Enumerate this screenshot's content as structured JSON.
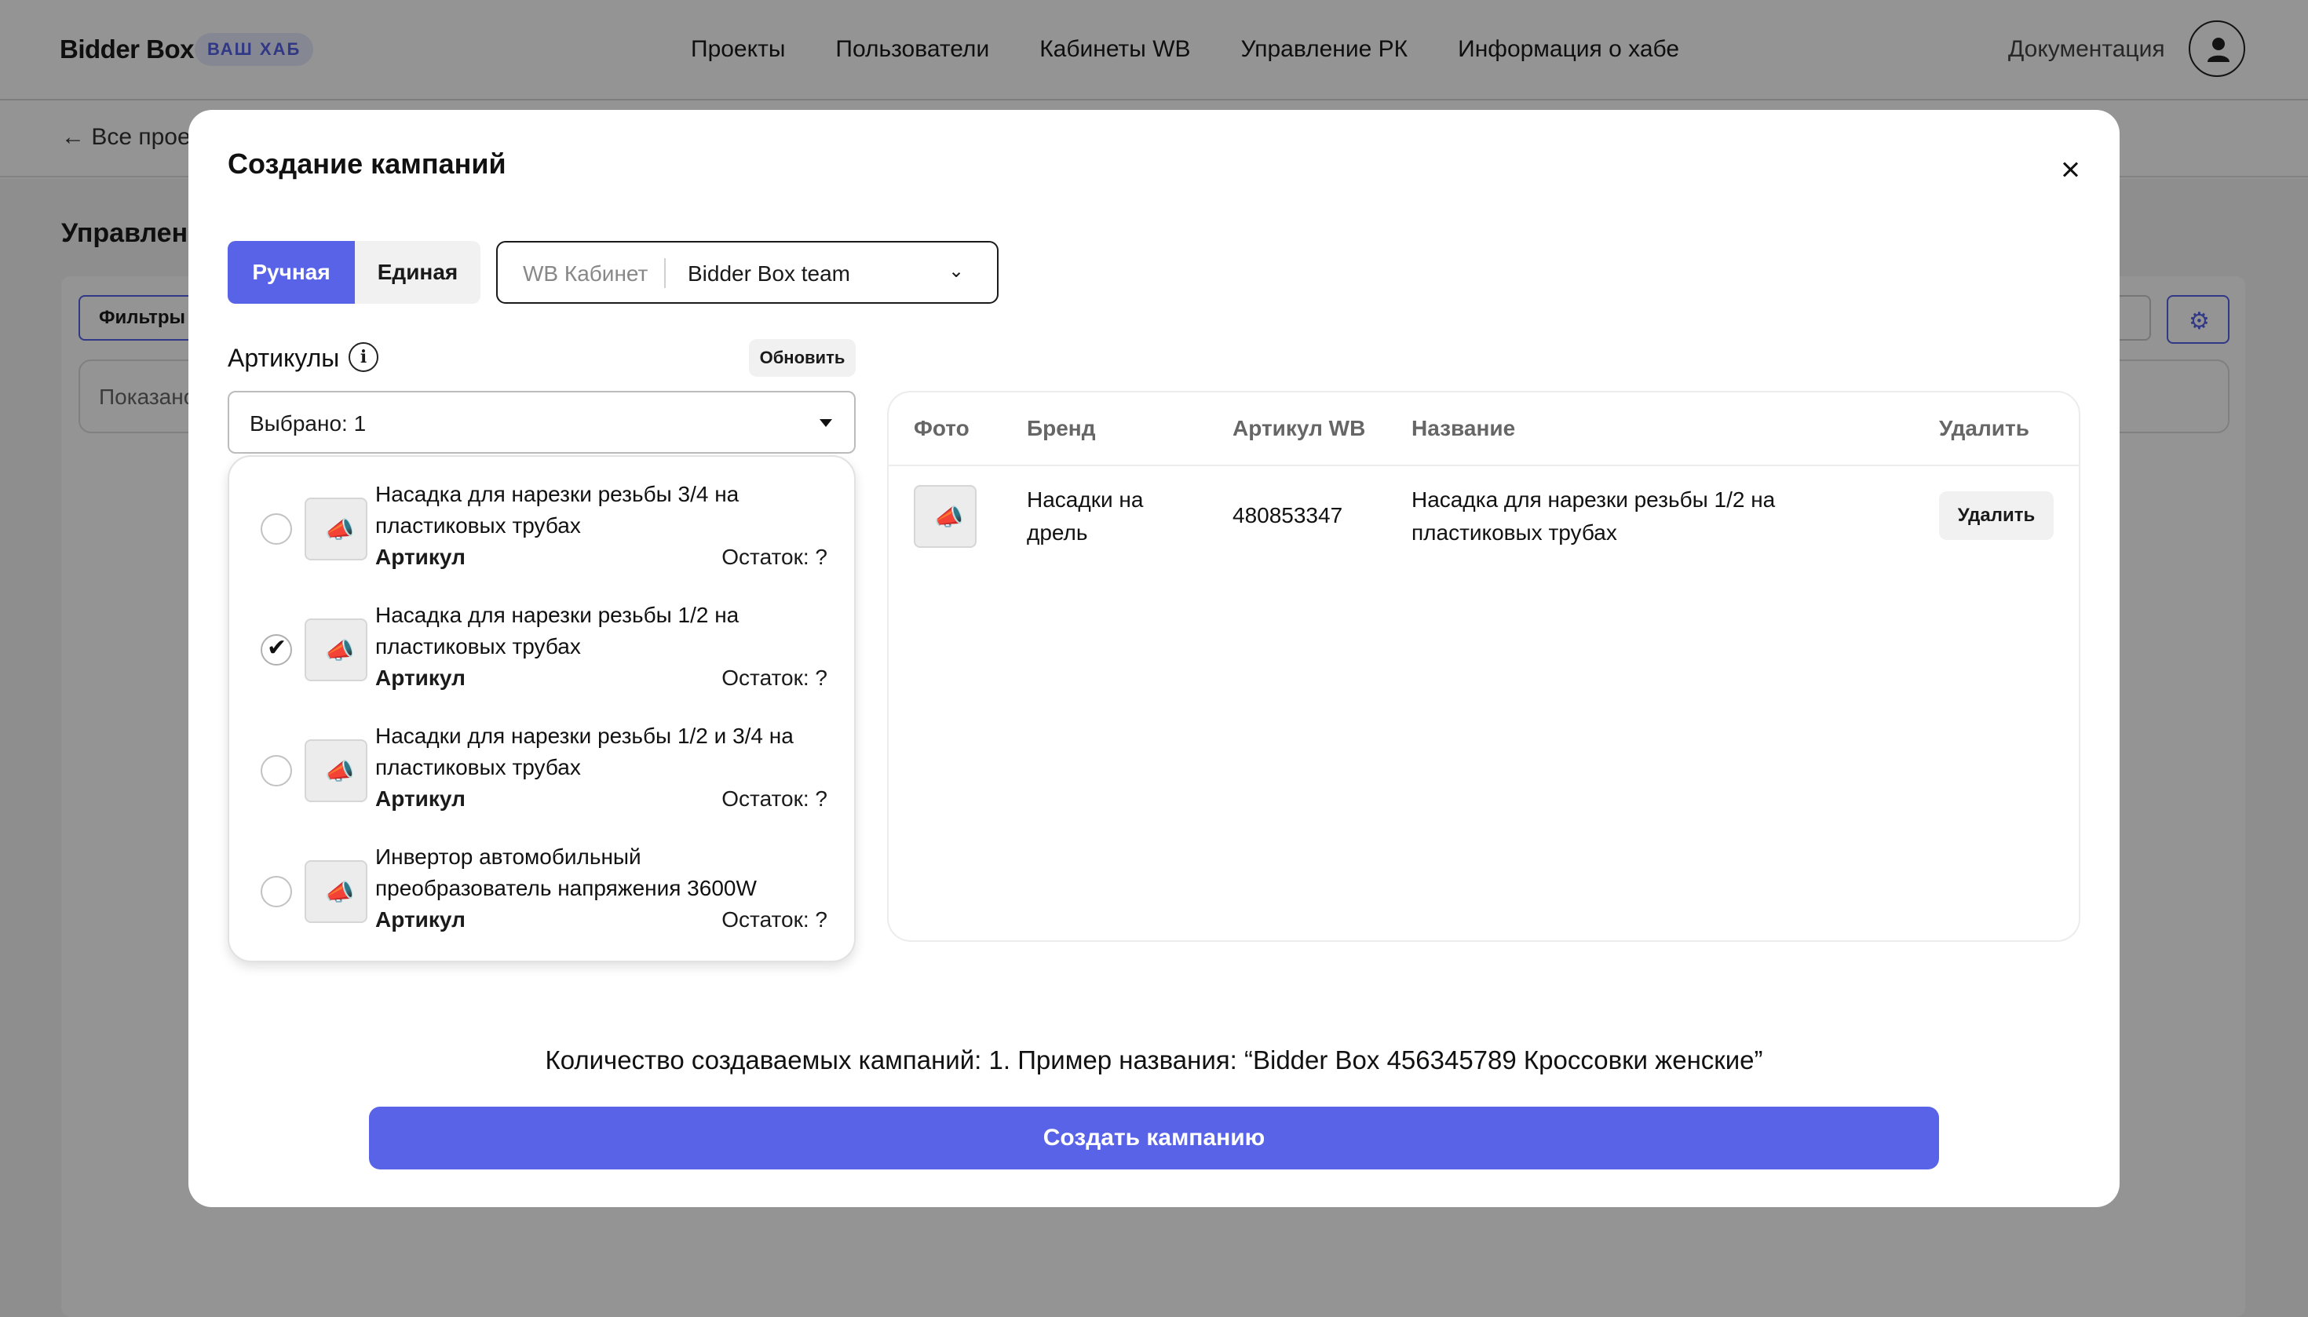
{
  "header": {
    "logo": "Bidder Box",
    "hub_badge": "ВАШ ХАБ",
    "nav": [
      "Проекты",
      "Пользователи",
      "Кабинеты WB",
      "Управление РК",
      "Информация о хабе"
    ],
    "docs": "Документация"
  },
  "background": {
    "back_link": "Все проек",
    "page_title": "Управлени",
    "filters_button": "Фильтры",
    "showing_text": "Показано"
  },
  "modal": {
    "title": "Создание кампаний",
    "mode_tabs": [
      {
        "label": "Ручная",
        "active": true
      },
      {
        "label": "Единая",
        "active": false
      }
    ],
    "cabinet": {
      "label": "WB Кабинет",
      "value": "Bidder Box team"
    },
    "articles": {
      "label": "Артикулы",
      "info_icon": "i",
      "refresh_button": "Обновить",
      "selected_text": "Выбрано: 1",
      "options": [
        {
          "name": "Насадка для нарезки резьбы 3/4 на пластиковых трубах",
          "article_label": "Артикул",
          "stock": "Остаток: ?",
          "checked": false
        },
        {
          "name": "Насадка для нарезки резьбы 1/2 на пластиковых трубах",
          "article_label": "Артикул",
          "stock": "Остаток: ?",
          "checked": true
        },
        {
          "name": "Насадки для нарезки резьбы 1/2 и 3/4 на пластиковых трубах",
          "article_label": "Артикул",
          "stock": "Остаток: ?",
          "checked": false
        },
        {
          "name": "Инвертор автомобильный преобразователь напряжения 3600W",
          "article_label": "Артикул",
          "stock": "Остаток: ?",
          "checked": false
        }
      ]
    },
    "table": {
      "headers": {
        "photo": "Фото",
        "brand": "Бренд",
        "article": "Артикул WB",
        "name": "Название",
        "delete": "Удалить"
      },
      "rows": [
        {
          "brand": "Насадки на дрель",
          "article": "480853347",
          "name": "Насадка для нарезки резьбы 1/2 на пластиковых трубах",
          "delete_label": "Удалить"
        }
      ]
    },
    "summary": "Количество создаваемых кампаний: 1. Пример названия: “Bidder Box 456345789 Кроссовки женские”",
    "create_button": "Создать кампанию"
  },
  "colors": {
    "accent": "#5863e8",
    "overlay": "rgba(0,0,0,0.42)"
  },
  "icons": [
    "arrow-left-icon",
    "user-icon",
    "gear-icon",
    "close-icon",
    "chevron-down-icon",
    "info-icon",
    "caret-down-icon",
    "megaphone-icon",
    "check-icon"
  ]
}
